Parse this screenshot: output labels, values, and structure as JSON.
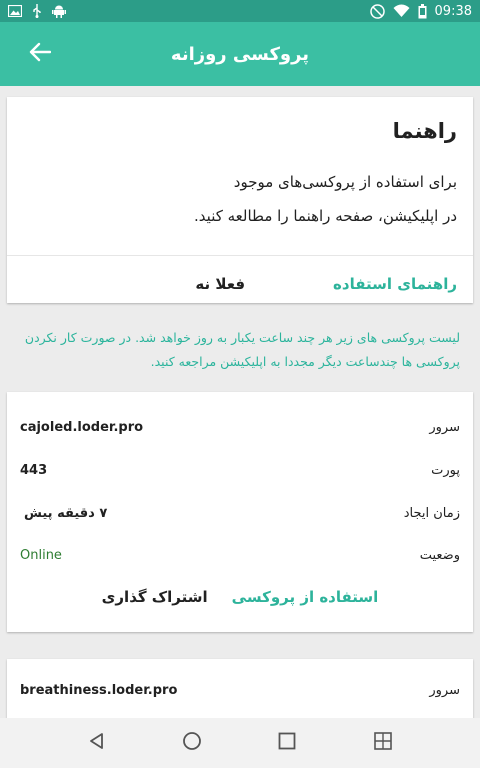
{
  "status_bar": {
    "time": "09:38",
    "icons": [
      "image-icon",
      "usb-icon",
      "android-icon",
      "do-not-disturb-icon",
      "wifi-icon",
      "battery-icon"
    ]
  },
  "app_bar": {
    "title": "پروکسی روزانه",
    "back_icon": "arrow-back-icon"
  },
  "guide_card": {
    "title": "راهنما",
    "line1": "برای استفاده از پروکسی‌های موجود",
    "line2": "در اپلیکیشن، صفحه راهنما را مطالعه کنید.",
    "guide_button": "راهنمای استفاده",
    "dismiss_button": "فعلا نه"
  },
  "info_text": "لیست پروکسی های زیر هر چند ساعت یکبار به روز خواهد شد. در صورت کار نکردن پروکسی ها چندساعت دیگر مجددا به اپلیکیشن مراجعه کنید.",
  "proxies": [
    {
      "server_label": "سرور",
      "server": "cajoled.loder.pro",
      "port_label": "پورت",
      "port": "443",
      "created_label": "زمان ایجاد",
      "created": "۷ دقیقه پیش",
      "status_label": "وضعیت",
      "status": "Online",
      "use_button": "استفاده از پروکسی",
      "share_button": "اشتراک گذاری"
    },
    {
      "server_label": "سرور",
      "server": "breathiness.loder.pro"
    }
  ],
  "colors": {
    "status_bar": "#2c9d88",
    "app_bar": "#3bbfa3",
    "accent": "#2db39b",
    "online": "#2e7d32",
    "background": "#ececec"
  },
  "nav_bar": {
    "icons": [
      "back-triangle-icon",
      "home-circle-icon",
      "recents-square-icon",
      "screenshot-icon"
    ]
  }
}
